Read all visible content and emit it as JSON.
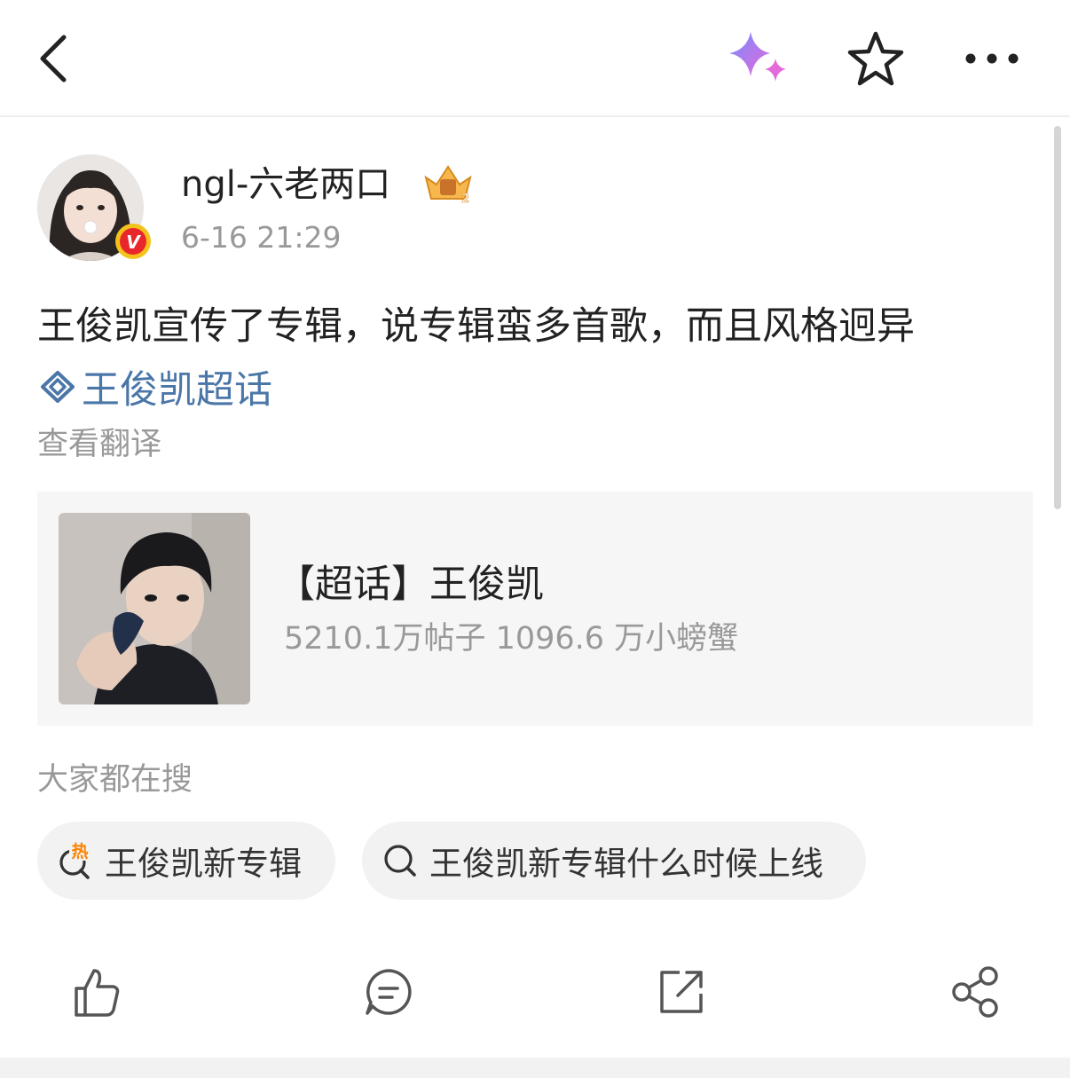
{
  "topbar": {
    "back_icon": "chevron-left-icon",
    "ai_icon": "sparkle-icon",
    "favorite_icon": "star-outline-icon",
    "more_icon": "more-horizontal-icon"
  },
  "post": {
    "username": "ngl-六老两口",
    "timestamp": "6-16 21:29",
    "badge_icon": "crown-badge-icon",
    "verified_mark": "V",
    "text": "王俊凯宣传了专辑，说专辑蛮多首歌，而且风格迥异",
    "topic_link": "王俊凯超话",
    "translate": "查看翻译"
  },
  "topic_card": {
    "title": "【超话】王俊凯",
    "stats": "5210.1万帖子 1096.6 万小螃蟹"
  },
  "searches": {
    "label": "大家都在搜",
    "hot_mark": "热",
    "items": [
      "王俊凯新专辑",
      "王俊凯新专辑什么时候上线"
    ]
  },
  "actions": [
    "like-icon",
    "comment-icon",
    "repost-icon",
    "share-icon"
  ],
  "colors": {
    "link": "#4a76a8",
    "secondary_text": "#999999",
    "hot": "#ff8200",
    "verified": "#e8262b"
  }
}
